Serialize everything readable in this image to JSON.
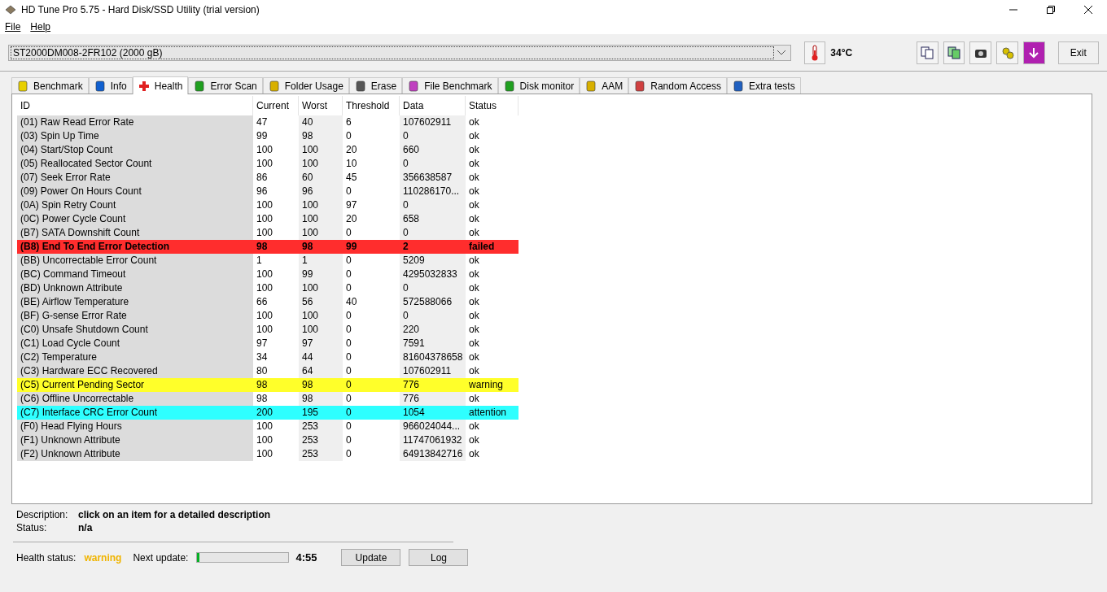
{
  "window": {
    "title": "HD Tune Pro 5.75 - Hard Disk/SSD Utility (trial version)"
  },
  "menu": [
    {
      "label": "File"
    },
    {
      "label": "Help"
    }
  ],
  "toolbar": {
    "drive": "ST2000DM008-2FR102 (2000 gB)",
    "temperature": "34°C",
    "exit": "Exit"
  },
  "tabs": [
    {
      "label": "Benchmark",
      "selected": false
    },
    {
      "label": "Info",
      "selected": false
    },
    {
      "label": "Health",
      "selected": true
    },
    {
      "label": "Error Scan",
      "selected": false
    },
    {
      "label": "Folder Usage",
      "selected": false
    },
    {
      "label": "Erase",
      "selected": false
    },
    {
      "label": "File Benchmark",
      "selected": false
    },
    {
      "label": "Disk monitor",
      "selected": false
    },
    {
      "label": "AAM",
      "selected": false
    },
    {
      "label": "Random Access",
      "selected": false
    },
    {
      "label": "Extra tests",
      "selected": false
    }
  ],
  "table": {
    "columns": [
      "ID",
      "Current",
      "Worst",
      "Threshold",
      "Data",
      "Status"
    ],
    "rows": [
      {
        "cells": [
          "(01) Raw Read Error Rate",
          "47",
          "40",
          "6",
          "107602911",
          "ok"
        ],
        "kind": "ok"
      },
      {
        "cells": [
          "(03) Spin Up Time",
          "99",
          "98",
          "0",
          "0",
          "ok"
        ],
        "kind": "ok"
      },
      {
        "cells": [
          "(04) Start/Stop Count",
          "100",
          "100",
          "20",
          "660",
          "ok"
        ],
        "kind": "ok"
      },
      {
        "cells": [
          "(05) Reallocated Sector Count",
          "100",
          "100",
          "10",
          "0",
          "ok"
        ],
        "kind": "ok"
      },
      {
        "cells": [
          "(07) Seek Error Rate",
          "86",
          "60",
          "45",
          "356638587",
          "ok"
        ],
        "kind": "ok"
      },
      {
        "cells": [
          "(09) Power On Hours Count",
          "96",
          "96",
          "0",
          "110286170...",
          "ok"
        ],
        "kind": "ok"
      },
      {
        "cells": [
          "(0A) Spin Retry Count",
          "100",
          "100",
          "97",
          "0",
          "ok"
        ],
        "kind": "ok"
      },
      {
        "cells": [
          "(0C) Power Cycle Count",
          "100",
          "100",
          "20",
          "658",
          "ok"
        ],
        "kind": "ok"
      },
      {
        "cells": [
          "(B7) SATA Downshift Count",
          "100",
          "100",
          "0",
          "0",
          "ok"
        ],
        "kind": "ok"
      },
      {
        "cells": [
          "(B8) End To End Error Detection",
          "98",
          "98",
          "99",
          "2",
          "failed"
        ],
        "kind": "failed"
      },
      {
        "cells": [
          "(BB) Uncorrectable Error Count",
          "1",
          "1",
          "0",
          "5209",
          "ok"
        ],
        "kind": "ok"
      },
      {
        "cells": [
          "(BC) Command Timeout",
          "100",
          "99",
          "0",
          "4295032833",
          "ok"
        ],
        "kind": "ok"
      },
      {
        "cells": [
          "(BD) Unknown Attribute",
          "100",
          "100",
          "0",
          "0",
          "ok"
        ],
        "kind": "ok"
      },
      {
        "cells": [
          "(BE) Airflow Temperature",
          "66",
          "56",
          "40",
          "572588066",
          "ok"
        ],
        "kind": "ok"
      },
      {
        "cells": [
          "(BF) G-sense Error Rate",
          "100",
          "100",
          "0",
          "0",
          "ok"
        ],
        "kind": "ok"
      },
      {
        "cells": [
          "(C0) Unsafe Shutdown Count",
          "100",
          "100",
          "0",
          "220",
          "ok"
        ],
        "kind": "ok"
      },
      {
        "cells": [
          "(C1) Load Cycle Count",
          "97",
          "97",
          "0",
          "7591",
          "ok"
        ],
        "kind": "ok"
      },
      {
        "cells": [
          "(C2) Temperature",
          "34",
          "44",
          "0",
          "81604378658",
          "ok"
        ],
        "kind": "ok"
      },
      {
        "cells": [
          "(C3) Hardware ECC Recovered",
          "80",
          "64",
          "0",
          "107602911",
          "ok"
        ],
        "kind": "ok"
      },
      {
        "cells": [
          "(C5) Current Pending Sector",
          "98",
          "98",
          "0",
          "776",
          "warning"
        ],
        "kind": "warning"
      },
      {
        "cells": [
          "(C6) Offline Uncorrectable",
          "98",
          "98",
          "0",
          "776",
          "ok"
        ],
        "kind": "ok"
      },
      {
        "cells": [
          "(C7) Interface CRC Error Count",
          "200",
          "195",
          "0",
          "1054",
          "attention"
        ],
        "kind": "attention"
      },
      {
        "cells": [
          "(F0) Head Flying Hours",
          "100",
          "253",
          "0",
          "966024044...",
          "ok"
        ],
        "kind": "ok"
      },
      {
        "cells": [
          "(F1) Unknown Attribute",
          "100",
          "253",
          "0",
          "11747061932",
          "ok"
        ],
        "kind": "ok"
      },
      {
        "cells": [
          "(F2) Unknown Attribute",
          "100",
          "253",
          "0",
          "64913842716",
          "ok"
        ],
        "kind": "ok"
      }
    ]
  },
  "details": [
    {
      "label": "Description:",
      "value": "click on an item for a detailed description"
    },
    {
      "label": "Status:",
      "value": "n/a"
    }
  ],
  "footer": {
    "health_label": "Health status:",
    "health_value": "warning",
    "next_label": "Next update:",
    "level": 0.02,
    "countdown": "4:55",
    "buttons": [
      "Update",
      "Log"
    ]
  }
}
